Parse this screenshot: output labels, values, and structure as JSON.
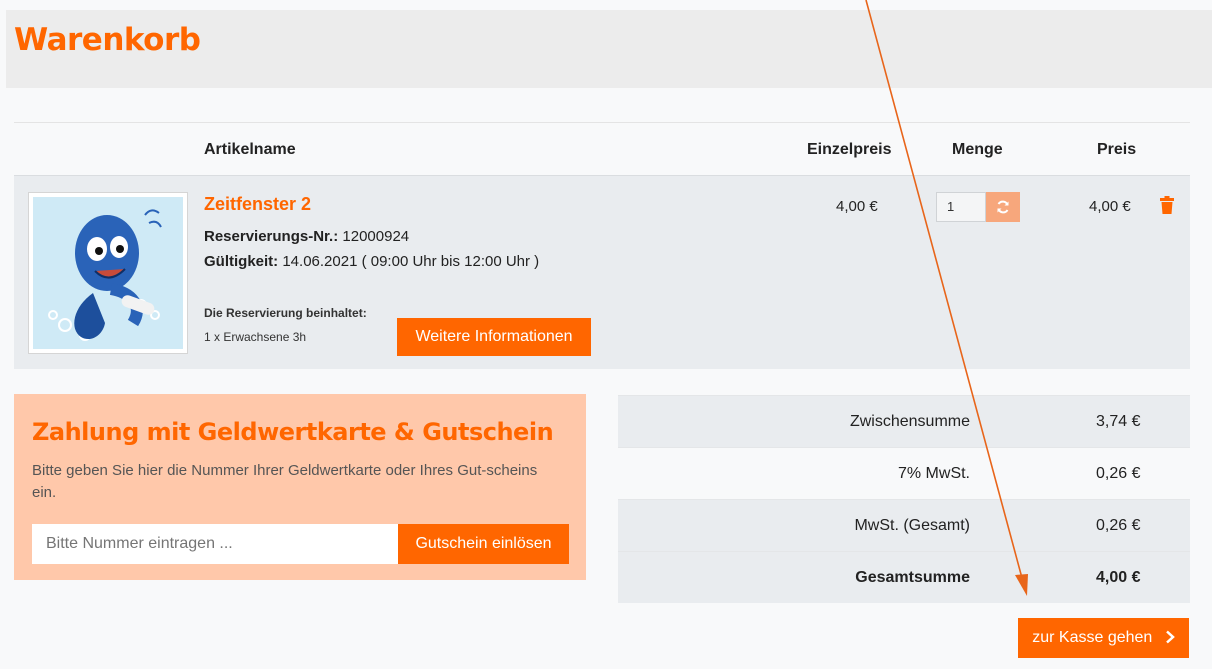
{
  "header": {
    "title": "Warenkorb"
  },
  "table": {
    "headers": {
      "name": "Artikelname",
      "unit_price": "Einzelpreis",
      "quantity": "Menge",
      "price": "Preis"
    }
  },
  "item": {
    "title": "Zeitfenster 2",
    "reservation_label": "Reservierungs-Nr.:",
    "reservation_value": "12000924",
    "validity_label": "Gültigkeit:",
    "validity_value": "14.06.2021 ( 09:00 Uhr bis 12:00 Uhr )",
    "includes_heading": "Die Reservierung beinhaltet:",
    "includes_item": "1 x Erwachsene 3h",
    "info_button": "Weitere Informationen",
    "unit_price": "4,00 €",
    "quantity": "1",
    "line_price": "4,00 €",
    "refresh_icon": "refresh-icon",
    "delete_icon": "trash-icon"
  },
  "voucher": {
    "title": "Zahlung mit Geldwertkarte & Gutschein",
    "description": "Bitte geben Sie hier die Nummer Ihrer Geldwertkarte oder Ihres Gut-scheins ein.",
    "placeholder": "Bitte Nummer eintragen ...",
    "button": "Gutschein einlösen"
  },
  "totals": [
    {
      "label": "Zwischensumme",
      "value": "3,74 €"
    },
    {
      "label": "7% MwSt.",
      "value": "0,26 €"
    },
    {
      "label": "MwSt. (Gesamt)",
      "value": "0,26 €"
    },
    {
      "label": "Gesamtsumme",
      "value": "4,00 €"
    }
  ],
  "checkout": {
    "label": "zur Kasse gehen",
    "icon": "chevron-right-icon"
  },
  "colors": {
    "accent": "#ff6600",
    "voucher_bg": "#ffc8aa",
    "row_bg": "#e9ecef"
  }
}
